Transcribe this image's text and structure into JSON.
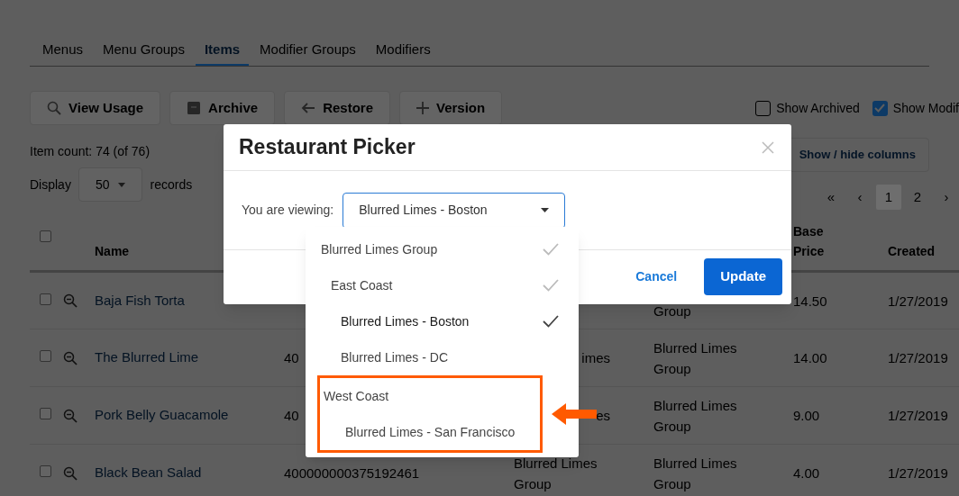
{
  "tabs": [
    {
      "label": "Menus",
      "selected": false
    },
    {
      "label": "Menu Groups",
      "selected": false
    },
    {
      "label": "Items",
      "selected": true
    },
    {
      "label": "Modifier Groups",
      "selected": false
    },
    {
      "label": "Modifiers",
      "selected": false
    }
  ],
  "toolbar": {
    "buttons": [
      {
        "label": "View Usage",
        "kind": "search"
      },
      {
        "label": "Archive",
        "kind": "archive"
      },
      {
        "label": "Restore",
        "kind": "restore"
      },
      {
        "label": "Version",
        "kind": "add"
      }
    ],
    "toggles": [
      {
        "label": "Show Archived",
        "checked": false
      },
      {
        "label": "Show Modif",
        "checked": true
      }
    ]
  },
  "item_count": "Item count: 74 (of 76)",
  "display": {
    "label": "Display",
    "value": "50",
    "suffix": "records"
  },
  "columns_button": "Show / hide columns",
  "pagination": [
    {
      "label": "«",
      "selected": false
    },
    {
      "label": "‹",
      "selected": false
    },
    {
      "label": "1",
      "selected": true
    },
    {
      "label": "2",
      "selected": false
    },
    {
      "label": "›",
      "selected": false
    }
  ],
  "table": {
    "select_all": {
      "checked": false
    },
    "header": {
      "name": "Name",
      "base_price": "Base Price",
      "created": "Created"
    },
    "rows": [
      {
        "checked": false,
        "name": "Baja Fish Torta",
        "column_4": "Group",
        "base_price": "14.50",
        "created": "1/27/2019"
      },
      {
        "checked": false,
        "name": "The Blurred Lime",
        "column_2": "40",
        "column_3": "imes",
        "column_4": "Blurred Limes Group",
        "base_price": "14.00",
        "created": "1/27/2019"
      },
      {
        "checked": false,
        "name": "Pork Belly Guacamole",
        "column_2": "40",
        "column_3": "es",
        "column_4": "Blurred Limes Group",
        "base_price": "9.00",
        "created": "1/27/2019"
      },
      {
        "checked": false,
        "name": "Black Bean Salad",
        "column_2": "400000000375192461",
        "column_3": "Blurred Limes Group",
        "column_4": "Blurred Limes Group",
        "base_price": "4.00",
        "created": "1/27/2019"
      }
    ]
  },
  "modal": {
    "title": "Restaurant Picker",
    "label": "You are viewing:",
    "value": "Blurred Limes - Boston",
    "cancel": "Cancel",
    "update": "Update"
  },
  "dropdown": {
    "items": [
      {
        "label": "Blurred Limes Group",
        "checked": true,
        "selected": false,
        "highlighted": false,
        "children": [
          {
            "label": "East Coast",
            "checked": true,
            "selected": false,
            "highlighted": false,
            "children": [
              {
                "label": "Blurred Limes - Boston",
                "checked": true,
                "selected": true,
                "highlighted": false
              },
              {
                "label": "Blurred Limes - DC",
                "checked": false,
                "selected": false,
                "highlighted": false
              }
            ]
          },
          {
            "label": "West Coast",
            "checked": false,
            "selected": false,
            "highlighted": true,
            "children": [
              {
                "label": "Blurred Limes - San Francisco",
                "checked": false,
                "selected": false,
                "highlighted": false
              }
            ]
          }
        ]
      }
    ]
  }
}
